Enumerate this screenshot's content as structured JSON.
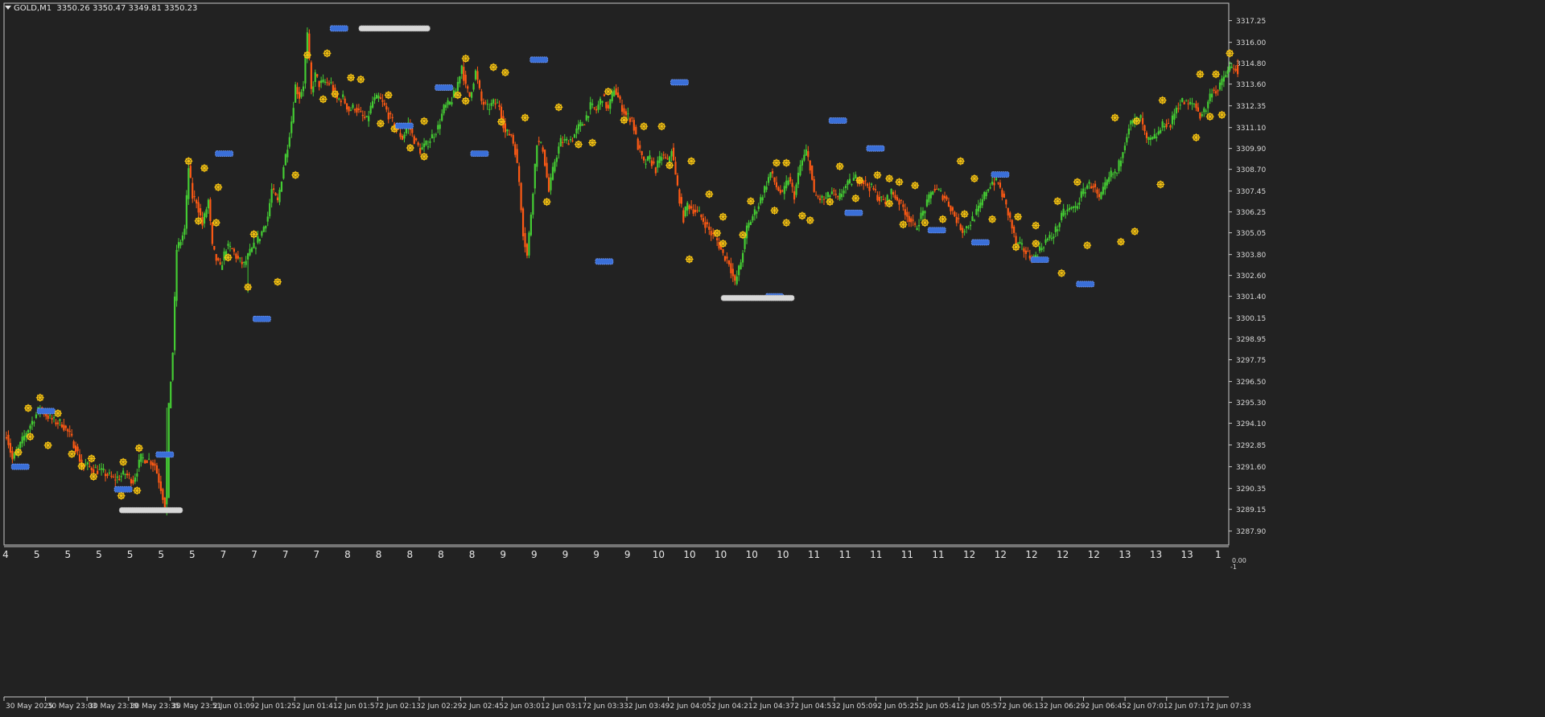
{
  "header": {
    "symbol": "GOLD,M1",
    "ohlc": "3350.26 3350.47 3349.81 3350.23"
  },
  "colors": {
    "background": "#222222",
    "bull_candle": "#44cc33",
    "bear_candle": "#ff5a14",
    "fractal_marker": "#f5c211",
    "level_marker": "#3a6fd8",
    "zone_marker": "#d8d8d8",
    "axis_text": "#d8d8d8"
  },
  "indicator_row": [
    "4",
    "5",
    "5",
    "5",
    "5",
    "5",
    "5",
    "7",
    "7",
    "7",
    "7",
    "8",
    "8",
    "8",
    "8",
    "8",
    "9",
    "9",
    "9",
    "9",
    "9",
    "10",
    "10",
    "10",
    "10",
    "10",
    "11",
    "11",
    "11",
    "11",
    "11",
    "12",
    "12",
    "12",
    "12",
    "12",
    "13",
    "13",
    "13",
    "1"
  ],
  "oscillator_scale": [
    "0.00",
    "-1"
  ],
  "chart_data": {
    "type": "candlestick",
    "title": "",
    "xlabel": "",
    "ylabel": "",
    "ylim": [
      3287.1,
      3318.25
    ],
    "y_ticks": [
      3317.25,
      3316.0,
      3314.8,
      3313.6,
      3312.35,
      3311.1,
      3309.9,
      3308.7,
      3307.45,
      3306.25,
      3305.05,
      3303.8,
      3302.6,
      3301.4,
      3300.15,
      3298.95,
      3297.75,
      3296.5,
      3295.3,
      3294.1,
      3292.85,
      3291.6,
      3290.35,
      3289.15,
      3287.9
    ],
    "y_tick_labels": [
      "3317.25",
      "3316.00",
      "3314.80",
      "3313.60",
      "3312.35",
      "3311.10",
      "3309.90",
      "3308.70",
      "3307.45",
      "3306.25",
      "3305.05",
      "3303.80",
      "3302.60",
      "3301.40",
      "3300.15",
      "3298.95",
      "3297.75",
      "3296.50",
      "3295.30",
      "3294.10",
      "3292.85",
      "3291.60",
      "3290.35",
      "3289.15",
      "3287.90"
    ],
    "x_tick_labels": [
      "30 May 2025",
      "30 May 23:03",
      "30 May 23:19",
      "30 May 23:35",
      "30 May 23:51",
      "2 Jun 01:09",
      "2 Jun 01:25",
      "2 Jun 01:41",
      "2 Jun 01:57",
      "2 Jun 02:13",
      "2 Jun 02:29",
      "2 Jun 02:45",
      "2 Jun 03:01",
      "2 Jun 03:17",
      "2 Jun 03:33",
      "2 Jun 03:49",
      "2 Jun 04:05",
      "2 Jun 04:21",
      "2 Jun 04:37",
      "2 Jun 04:53",
      "2 Jun 05:09",
      "2 Jun 05:25",
      "2 Jun 05:41",
      "2 Jun 05:57",
      "2 Jun 06:13",
      "2 Jun 06:29",
      "2 Jun 06:45",
      "2 Jun 07:01",
      "2 Jun 07:17",
      "2 Jun 07:33"
    ],
    "close_path": [
      [
        0,
        3293.5
      ],
      [
        3,
        3292.0
      ],
      [
        6,
        3292.6
      ],
      [
        10,
        3293.6
      ],
      [
        14,
        3294.4
      ],
      [
        17,
        3295.0
      ],
      [
        20,
        3294.6
      ],
      [
        24,
        3294.2
      ],
      [
        28,
        3294.1
      ],
      [
        32,
        3293.4
      ],
      [
        35,
        3292.7
      ],
      [
        38,
        3291.7
      ],
      [
        42,
        3291.6
      ],
      [
        46,
        3291.4
      ],
      [
        50,
        3291.2
      ],
      [
        54,
        3290.9
      ],
      [
        57,
        3291.0
      ],
      [
        60,
        3291.2
      ],
      [
        64,
        3290.8
      ],
      [
        68,
        3292.1
      ],
      [
        72,
        3292.0
      ],
      [
        75,
        3291.7
      ],
      [
        78,
        3290.4
      ],
      [
        80,
        3289.4
      ],
      [
        82,
        3295.0
      ],
      [
        84,
        3298.2
      ],
      [
        86,
        3304.1
      ],
      [
        88,
        3304.6
      ],
      [
        90,
        3305.2
      ],
      [
        92,
        3308.8
      ],
      [
        94,
        3307.1
      ],
      [
        96,
        3306.9
      ],
      [
        99,
        3305.5
      ],
      [
        102,
        3306.9
      ],
      [
        104,
        3304.2
      ],
      [
        106,
        3303.5
      ],
      [
        108,
        3303.0
      ],
      [
        111,
        3304.2
      ],
      [
        114,
        3304.1
      ],
      [
        117,
        3303.5
      ],
      [
        120,
        3303.2
      ],
      [
        123,
        3303.9
      ],
      [
        126,
        3304.4
      ],
      [
        129,
        3305.1
      ],
      [
        132,
        3306.0
      ],
      [
        134,
        3307.5
      ],
      [
        137,
        3306.8
      ],
      [
        140,
        3308.9
      ],
      [
        142,
        3310.1
      ],
      [
        144,
        3311.5
      ],
      [
        146,
        3313.5
      ],
      [
        148,
        3312.9
      ],
      [
        150,
        3313.6
      ],
      [
        152,
        3316.4
      ],
      [
        154,
        3313.2
      ],
      [
        156,
        3314.1
      ],
      [
        158,
        3313.6
      ],
      [
        161,
        3313.7
      ],
      [
        164,
        3313.6
      ],
      [
        167,
        3312.7
      ],
      [
        170,
        3312.8
      ],
      [
        173,
        3312.1
      ],
      [
        176,
        3312.3
      ],
      [
        179,
        3311.8
      ],
      [
        182,
        3311.5
      ],
      [
        185,
        3312.6
      ],
      [
        188,
        3312.8
      ],
      [
        191,
        3312.3
      ],
      [
        194,
        3311.6
      ],
      [
        197,
        3311.0
      ],
      [
        200,
        3310.5
      ],
      [
        203,
        3311.3
      ],
      [
        206,
        3310.4
      ],
      [
        209,
        3309.8
      ],
      [
        212,
        3310.1
      ],
      [
        215,
        3310.6
      ],
      [
        218,
        3311.1
      ],
      [
        221,
        3312.2
      ],
      [
        224,
        3312.5
      ],
      [
        227,
        3313.2
      ],
      [
        230,
        3314.7
      ],
      [
        232,
        3313.4
      ],
      [
        234,
        3312.9
      ],
      [
        237,
        3314.3
      ],
      [
        240,
        3312.6
      ],
      [
        243,
        3312.2
      ],
      [
        246,
        3312.5
      ],
      [
        249,
        3312.4
      ],
      [
        252,
        3310.8
      ],
      [
        255,
        3310.7
      ],
      [
        257,
        3309.8
      ],
      [
        259,
        3308.0
      ],
      [
        261,
        3305.1
      ],
      [
        263,
        3303.7
      ],
      [
        265,
        3306.2
      ],
      [
        268,
        3310.3
      ],
      [
        271,
        3309.9
      ],
      [
        274,
        3307.4
      ],
      [
        277,
        3309.2
      ],
      [
        280,
        3310.3
      ],
      [
        283,
        3310.3
      ],
      [
        286,
        3310.5
      ],
      [
        289,
        3311.1
      ],
      [
        292,
        3311.5
      ],
      [
        295,
        3312.3
      ],
      [
        298,
        3312.1
      ],
      [
        301,
        3312.9
      ],
      [
        304,
        3312.1
      ],
      [
        307,
        3313.4
      ],
      [
        310,
        3312.5
      ],
      [
        313,
        3311.8
      ],
      [
        316,
        3311.6
      ],
      [
        319,
        3310.0
      ],
      [
        322,
        3309.0
      ],
      [
        325,
        3309.3
      ],
      [
        328,
        3308.7
      ],
      [
        331,
        3309.5
      ],
      [
        334,
        3309.1
      ],
      [
        336,
        3309.9
      ],
      [
        338,
        3308.3
      ],
      [
        340,
        3307.0
      ],
      [
        342,
        3305.9
      ],
      [
        344,
        3306.7
      ],
      [
        347,
        3306.4
      ],
      [
        350,
        3306.1
      ],
      [
        353,
        3305.6
      ],
      [
        356,
        3305.0
      ],
      [
        359,
        3304.6
      ],
      [
        362,
        3303.8
      ],
      [
        365,
        3303.4
      ],
      [
        368,
        3302.1
      ],
      [
        371,
        3303.4
      ],
      [
        374,
        3305.3
      ],
      [
        377,
        3306.0
      ],
      [
        380,
        3306.7
      ],
      [
        383,
        3307.6
      ],
      [
        386,
        3308.5
      ],
      [
        389,
        3307.7
      ],
      [
        392,
        3307.2
      ],
      [
        395,
        3308.2
      ],
      [
        398,
        3307.2
      ],
      [
        401,
        3308.9
      ],
      [
        404,
        3309.7
      ],
      [
        406,
        3308.9
      ],
      [
        408,
        3307.2
      ],
      [
        411,
        3307.0
      ],
      [
        414,
        3307.0
      ],
      [
        417,
        3307.4
      ],
      [
        420,
        3306.9
      ],
      [
        423,
        3307.6
      ],
      [
        426,
        3307.9
      ],
      [
        429,
        3308.2
      ],
      [
        432,
        3308.1
      ],
      [
        435,
        3307.8
      ],
      [
        438,
        3307.5
      ],
      [
        441,
        3307.0
      ],
      [
        444,
        3306.8
      ],
      [
        447,
        3307.4
      ],
      [
        450,
        3307.0
      ],
      [
        453,
        3306.5
      ],
      [
        456,
        3305.9
      ],
      [
        459,
        3305.3
      ],
      [
        462,
        3306.0
      ],
      [
        465,
        3306.7
      ],
      [
        468,
        3307.6
      ],
      [
        471,
        3307.4
      ],
      [
        474,
        3307.1
      ],
      [
        477,
        3306.5
      ],
      [
        480,
        3305.8
      ],
      [
        483,
        3305.2
      ],
      [
        486,
        3305.5
      ],
      [
        489,
        3306.0
      ],
      [
        492,
        3306.6
      ],
      [
        495,
        3307.5
      ],
      [
        498,
        3308.0
      ],
      [
        501,
        3307.9
      ],
      [
        504,
        3306.9
      ],
      [
        507,
        3305.8
      ],
      [
        510,
        3304.4
      ],
      [
        513,
        3304.2
      ],
      [
        516,
        3303.8
      ],
      [
        519,
        3303.6
      ],
      [
        522,
        3304.1
      ],
      [
        525,
        3304.6
      ],
      [
        528,
        3304.8
      ],
      [
        531,
        3305.4
      ],
      [
        534,
        3306.2
      ],
      [
        537,
        3306.4
      ],
      [
        540,
        3306.5
      ],
      [
        543,
        3307.2
      ],
      [
        546,
        3307.8
      ],
      [
        549,
        3307.8
      ],
      [
        552,
        3306.9
      ],
      [
        555,
        3307.7
      ],
      [
        558,
        3308.4
      ],
      [
        561,
        3308.5
      ],
      [
        564,
        3309.9
      ],
      [
        567,
        3311.2
      ],
      [
        570,
        3311.5
      ],
      [
        573,
        3311.6
      ],
      [
        576,
        3310.3
      ],
      [
        579,
        3310.4
      ],
      [
        582,
        3310.8
      ],
      [
        585,
        3311.4
      ],
      [
        588,
        3311.2
      ],
      [
        591,
        3312.3
      ],
      [
        594,
        3312.6
      ],
      [
        597,
        3312.4
      ],
      [
        600,
        3312.5
      ],
      [
        603,
        3311.8
      ],
      [
        606,
        3312.2
      ],
      [
        609,
        3313.3
      ],
      [
        612,
        3313.2
      ],
      [
        615,
        3314.0
      ],
      [
        618,
        3314.5
      ],
      [
        621,
        3314.6
      ],
      [
        622,
        3313.9
      ]
    ],
    "fractal_highs": [
      [
        11,
        3294.6
      ],
      [
        17,
        3295.2
      ],
      [
        26,
        3294.3
      ],
      [
        43,
        3291.7
      ],
      [
        59,
        3291.5
      ],
      [
        67,
        3292.3
      ],
      [
        92,
        3308.8
      ],
      [
        100,
        3308.4
      ],
      [
        107,
        3307.3
      ],
      [
        125,
        3304.6
      ],
      [
        146,
        3308.0
      ],
      [
        152,
        3314.9
      ],
      [
        162,
        3315.0
      ],
      [
        174,
        3313.6
      ],
      [
        179,
        3313.5
      ],
      [
        193,
        3312.6
      ],
      [
        211,
        3311.1
      ],
      [
        228,
        3312.6
      ],
      [
        232,
        3314.7
      ],
      [
        246,
        3314.2
      ],
      [
        252,
        3313.9
      ],
      [
        262,
        3311.3
      ],
      [
        279,
        3311.9
      ],
      [
        304,
        3312.8
      ],
      [
        322,
        3310.8
      ],
      [
        331,
        3310.8
      ],
      [
        346,
        3308.8
      ],
      [
        355,
        3306.9
      ],
      [
        362,
        3305.6
      ],
      [
        376,
        3306.5
      ],
      [
        389,
        3308.7
      ],
      [
        394,
        3308.7
      ],
      [
        406,
        3305.4
      ],
      [
        421,
        3308.5
      ],
      [
        431,
        3307.7
      ],
      [
        440,
        3308.0
      ],
      [
        446,
        3307.8
      ],
      [
        451,
        3307.6
      ],
      [
        459,
        3307.4
      ],
      [
        482,
        3308.8
      ],
      [
        489,
        3307.8
      ],
      [
        511,
        3305.6
      ],
      [
        520,
        3305.1
      ],
      [
        531,
        3306.5
      ],
      [
        541,
        3307.6
      ],
      [
        560,
        3311.3
      ],
      [
        571,
        3311.1
      ],
      [
        584,
        3312.3
      ],
      [
        603,
        3313.8
      ],
      [
        611,
        3313.8
      ],
      [
        618,
        3315.0
      ]
    ],
    "fractal_lows": [
      [
        6,
        3292.8
      ],
      [
        12,
        3293.7
      ],
      [
        21,
        3293.2
      ],
      [
        33,
        3292.7
      ],
      [
        38,
        3292.0
      ],
      [
        44,
        3291.4
      ],
      [
        58,
        3290.3
      ],
      [
        66,
        3290.6
      ],
      [
        97,
        3306.1
      ],
      [
        106,
        3306.0
      ],
      [
        112,
        3304.0
      ],
      [
        122,
        3302.3
      ],
      [
        137,
        3302.6
      ],
      [
        160,
        3313.1
      ],
      [
        166,
        3313.4
      ],
      [
        189,
        3311.7
      ],
      [
        196,
        3311.4
      ],
      [
        204,
        3310.3
      ],
      [
        211,
        3309.8
      ],
      [
        232,
        3313.0
      ],
      [
        250,
        3311.8
      ],
      [
        273,
        3307.2
      ],
      [
        289,
        3310.5
      ],
      [
        296,
        3310.6
      ],
      [
        312,
        3311.9
      ],
      [
        335,
        3309.3
      ],
      [
        345,
        3303.9
      ],
      [
        359,
        3305.4
      ],
      [
        362,
        3304.8
      ],
      [
        372,
        3305.3
      ],
      [
        388,
        3306.7
      ],
      [
        394,
        3306.0
      ],
      [
        402,
        3306.4
      ],
      [
        416,
        3307.2
      ],
      [
        429,
        3307.4
      ],
      [
        446,
        3307.1
      ],
      [
        453,
        3305.9
      ],
      [
        464,
        3306.0
      ],
      [
        473,
        3306.2
      ],
      [
        484,
        3306.5
      ],
      [
        498,
        3306.2
      ],
      [
        510,
        3304.6
      ],
      [
        520,
        3304.8
      ],
      [
        533,
        3303.1
      ],
      [
        546,
        3304.7
      ],
      [
        563,
        3304.9
      ],
      [
        570,
        3305.5
      ],
      [
        583,
        3308.2
      ],
      [
        601,
        3310.9
      ],
      [
        608,
        3312.1
      ],
      [
        614,
        3312.2
      ]
    ],
    "level_markers": [
      [
        7,
        3291.6
      ],
      [
        20,
        3294.8
      ],
      [
        59,
        3290.3
      ],
      [
        80,
        3292.3
      ],
      [
        110,
        3309.6
      ],
      [
        129,
        3300.1
      ],
      [
        168,
        3316.8
      ],
      [
        201,
        3311.2
      ],
      [
        221,
        3313.4
      ],
      [
        239,
        3309.6
      ],
      [
        269,
        3315.0
      ],
      [
        302,
        3303.4
      ],
      [
        340,
        3313.7
      ],
      [
        388,
        3301.4
      ],
      [
        420,
        3311.5
      ],
      [
        428,
        3306.2
      ],
      [
        439,
        3309.9
      ],
      [
        470,
        3305.2
      ],
      [
        492,
        3304.5
      ],
      [
        502,
        3308.4
      ],
      [
        522,
        3303.5
      ],
      [
        545,
        3302.1
      ]
    ],
    "zone_markers": [
      [
        57,
        89,
        3289.1
      ],
      [
        178,
        214,
        3316.8
      ],
      [
        361,
        398,
        3301.3
      ]
    ]
  }
}
